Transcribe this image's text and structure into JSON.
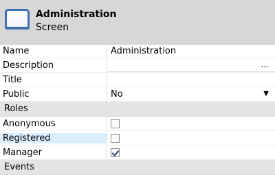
{
  "header": {
    "title": "Administration",
    "subtitle": "Screen",
    "icon": "screen-icon"
  },
  "properties": [
    {
      "label": "Name",
      "value": "Administration"
    },
    {
      "label": "Description",
      "value": "",
      "button": "..."
    },
    {
      "label": "Title",
      "value": ""
    },
    {
      "label": "Public",
      "value": "No",
      "dropdown": "▼"
    }
  ],
  "sections": {
    "roles": "Roles",
    "events": "Events"
  },
  "roles": [
    {
      "label": "Anonymous",
      "checked": false
    },
    {
      "label": "Registered",
      "checked": false
    },
    {
      "label": "Manager",
      "checked": true
    }
  ]
}
